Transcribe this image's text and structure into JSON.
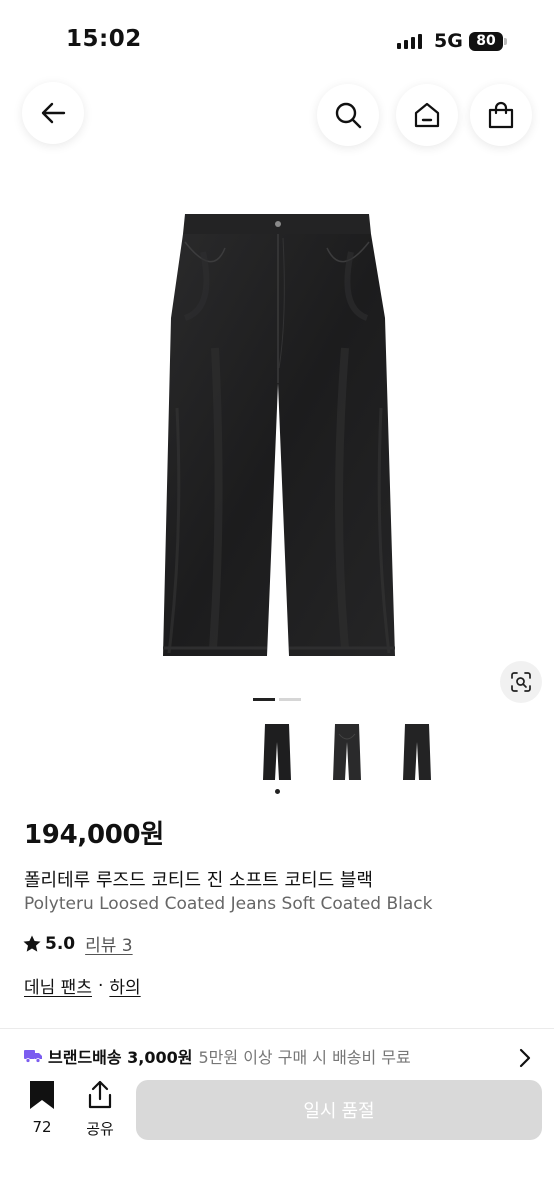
{
  "status_bar": {
    "time": "15:02",
    "network": "5G",
    "battery": "80"
  },
  "nav": {
    "back_icon": "arrow-left-icon",
    "search_icon": "search-icon",
    "home_icon": "home-icon",
    "cart_icon": "shopping-bag-icon"
  },
  "gallery": {
    "image_subject": "black wide-leg jeans",
    "lens_icon": "visual-search-icon",
    "current_index": 1,
    "thumbnail_count": 3
  },
  "product": {
    "price": "194,000원",
    "name_ko": "폴리테루 루즈드 코티드 진 소프트 코티드 블랙",
    "name_en": "Polyteru Loosed Coated Jeans Soft Coated Black",
    "rating_score": "5.0",
    "review_label": "리뷰 3",
    "category_primary": "데님 팬츠",
    "category_separator": "·",
    "category_secondary": "하의"
  },
  "shipping": {
    "icon": "truck-icon",
    "label": "브랜드배송 3,000원",
    "note": "5만원 이상 구매 시 배송비 무료"
  },
  "bottom_bar": {
    "bookmark_count": "72",
    "share_label": "공유",
    "buy_label": "일시 품절"
  },
  "colors": {
    "accent": "#111111",
    "truck": "#7b5cf0",
    "disabled_button": "#d9d9d9",
    "denim": "#1f1f20"
  }
}
